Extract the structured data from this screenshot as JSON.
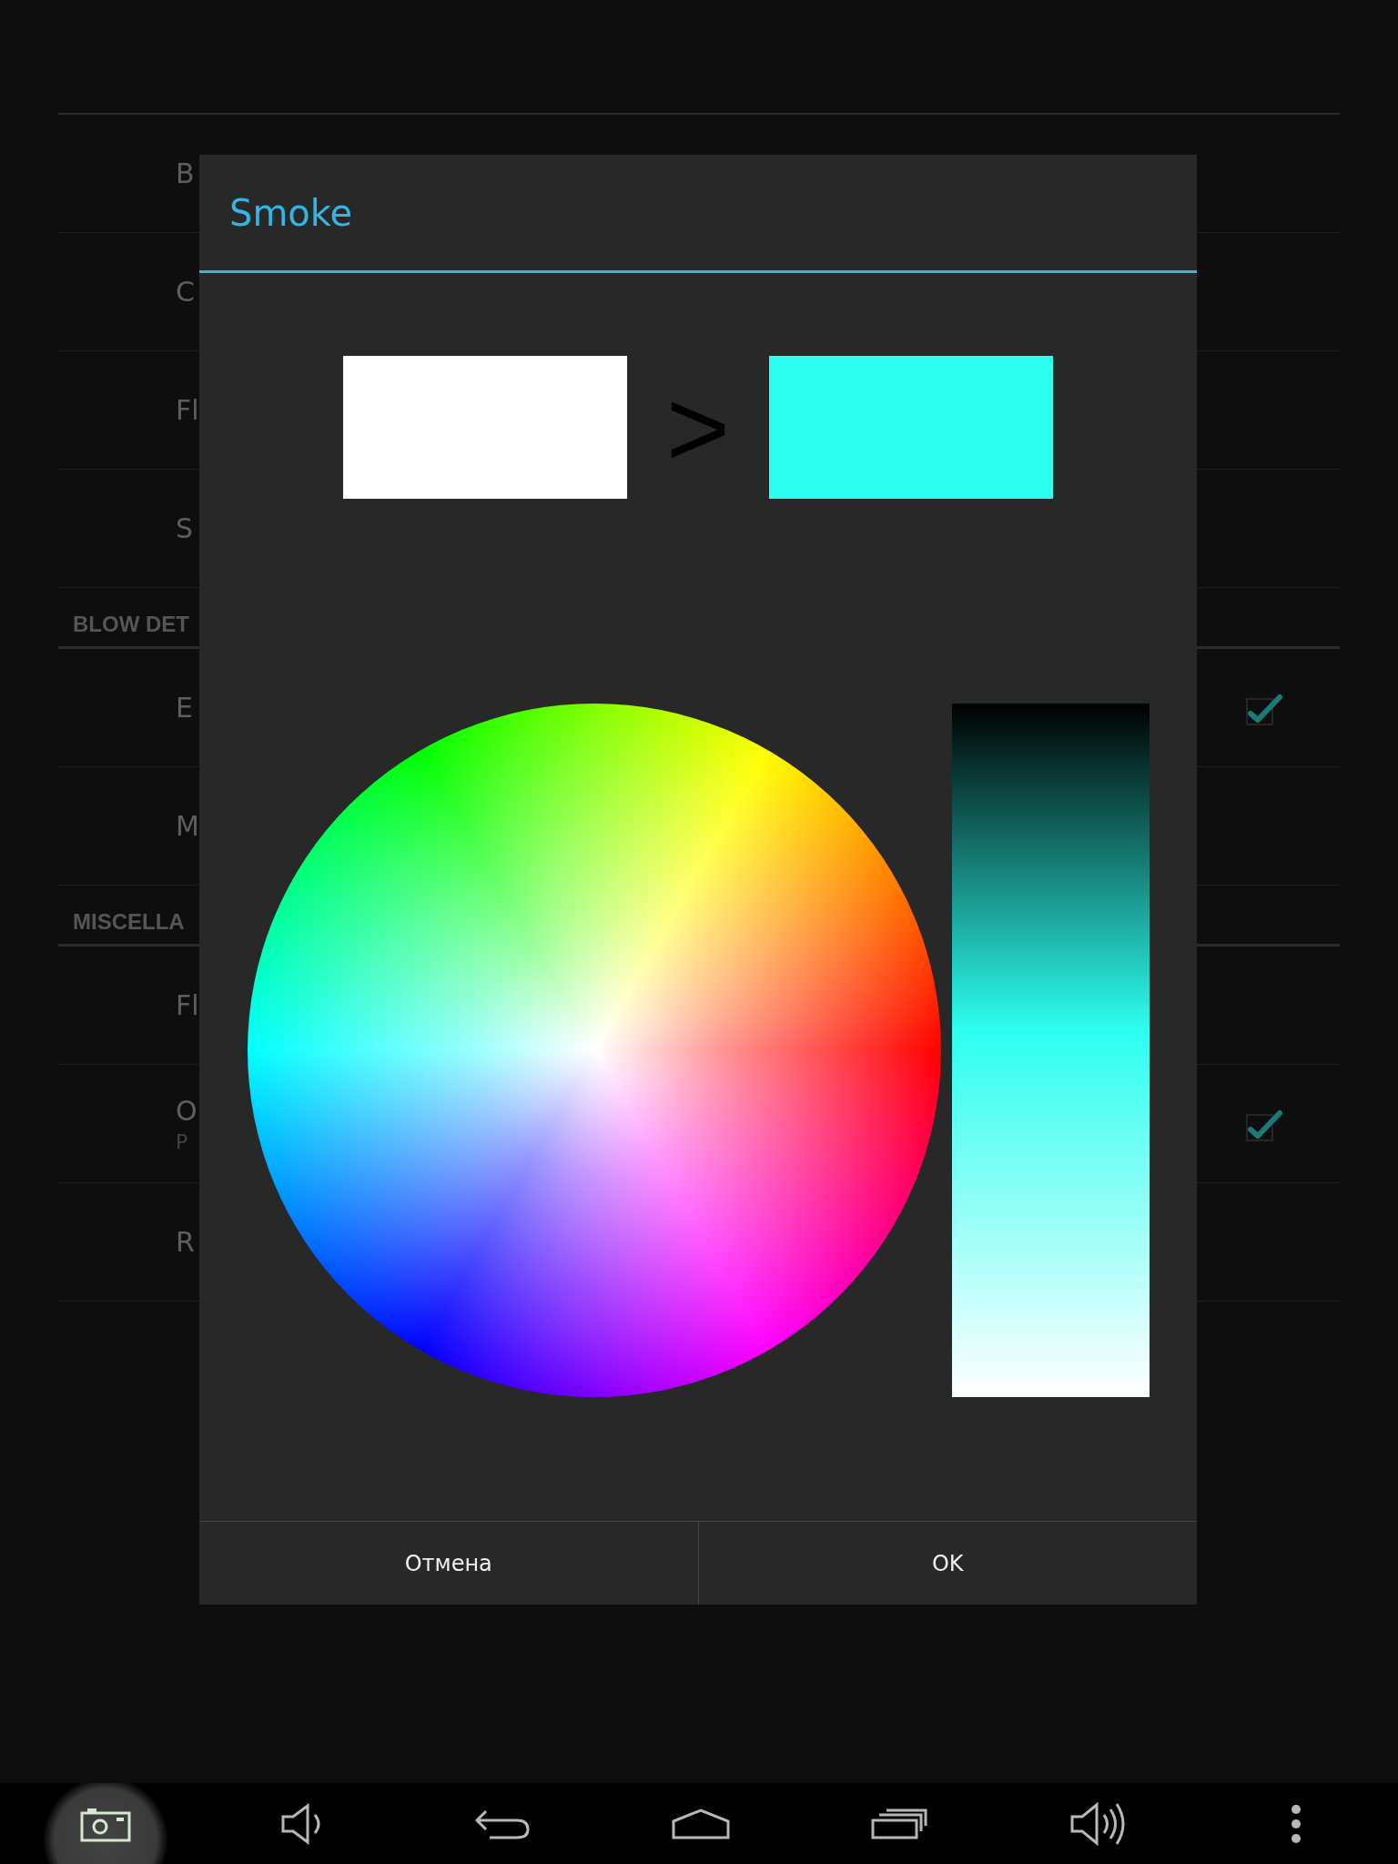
{
  "settings_list": [
    {
      "kind": "row",
      "title": "B"
    },
    {
      "kind": "row",
      "title": "C"
    },
    {
      "kind": "row",
      "title": "Fl"
    },
    {
      "kind": "row",
      "title": "S"
    },
    {
      "kind": "header",
      "title": "BLOW DET"
    },
    {
      "kind": "checkbox",
      "title": "E",
      "checked": true
    },
    {
      "kind": "row",
      "title": "M"
    },
    {
      "kind": "header",
      "title": "MISCELLA"
    },
    {
      "kind": "row",
      "title": "Fl"
    },
    {
      "kind": "checkbox",
      "title": "O",
      "subtitle": "P",
      "checked": true
    },
    {
      "kind": "row",
      "title": "R"
    }
  ],
  "dialog": {
    "title": "Smoke",
    "swatches": [
      {
        "color": "#ffffff"
      },
      {
        "color": "#2cfff0"
      }
    ],
    "separator": ">",
    "buttons": [
      "Отмена",
      "OK"
    ]
  }
}
